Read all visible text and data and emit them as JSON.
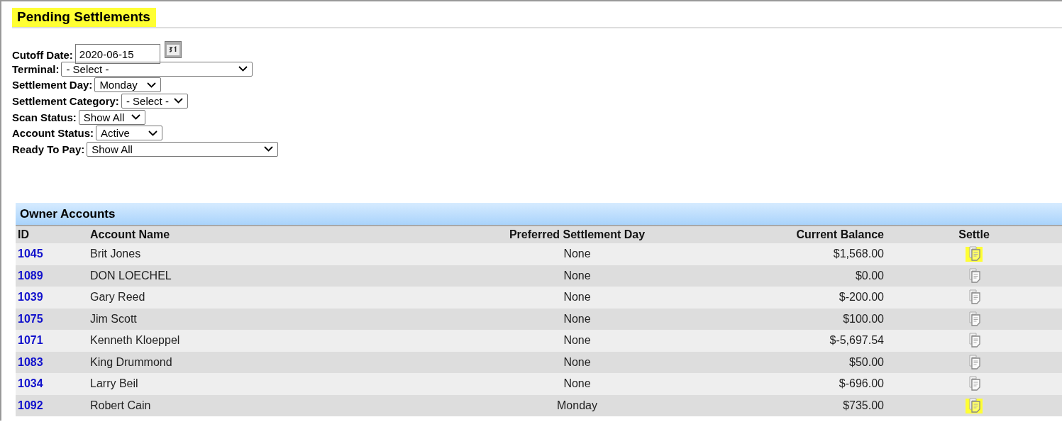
{
  "page": {
    "title": "Pending Settlements",
    "title_highlighted": true
  },
  "filters": [
    {
      "kind": "date",
      "label": "Cutoff Date:",
      "value": "2020-06-15"
    },
    {
      "kind": "select",
      "label": "Terminal:",
      "value": "- Select -"
    },
    {
      "kind": "select",
      "label": "Settlement Day:",
      "value": "Monday"
    },
    {
      "kind": "select",
      "label": "Settlement Category:",
      "value": "- Select -"
    },
    {
      "kind": "select",
      "label": "Scan Status:",
      "value": "Show All"
    },
    {
      "kind": "select",
      "label": "Account Status:",
      "value": "Active"
    },
    {
      "kind": "select",
      "label": "Ready To Pay:",
      "value": "Show All"
    }
  ],
  "table": {
    "title": "Owner Accounts",
    "columns": [
      "ID",
      "Account Name",
      "Preferred Settlement Day",
      "Current Balance",
      "Settle"
    ],
    "rows": [
      {
        "id": "1045",
        "name": "Brit Jones",
        "day": "None",
        "balance": "$1,568.00",
        "highlighted": true
      },
      {
        "id": "1089",
        "name": "DON LOECHEL",
        "day": "None",
        "balance": "$0.00",
        "highlighted": false
      },
      {
        "id": "1039",
        "name": "Gary Reed",
        "day": "None",
        "balance": "$-200.00",
        "highlighted": false
      },
      {
        "id": "1075",
        "name": "Jim Scott",
        "day": "None",
        "balance": "$100.00",
        "highlighted": false
      },
      {
        "id": "1071",
        "name": "Kenneth Kloeppel",
        "day": "None",
        "balance": "$-5,697.54",
        "highlighted": false
      },
      {
        "id": "1083",
        "name": "King Drummond",
        "day": "None",
        "balance": "$50.00",
        "highlighted": false
      },
      {
        "id": "1034",
        "name": "Larry Beil",
        "day": "None",
        "balance": "$-696.00",
        "highlighted": false
      },
      {
        "id": "1092",
        "name": "Robert Cain",
        "day": "Monday",
        "balance": "$735.00",
        "highlighted": true
      }
    ]
  }
}
